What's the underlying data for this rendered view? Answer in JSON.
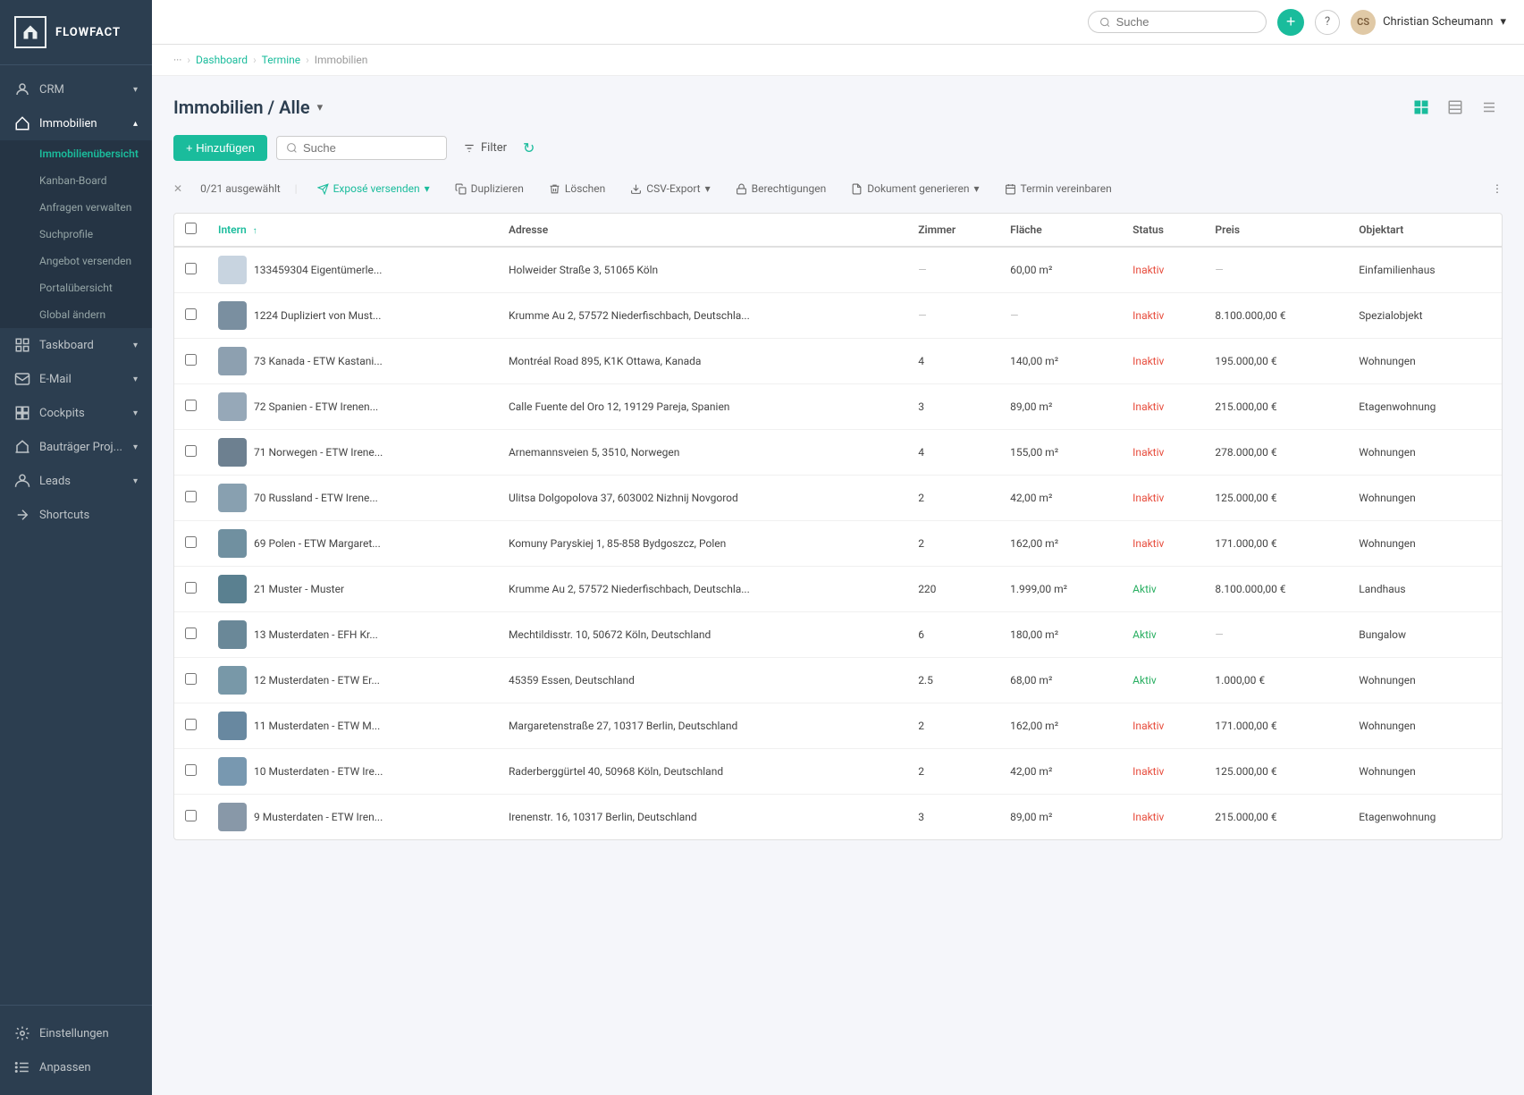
{
  "app": {
    "name": "FLOWFACT"
  },
  "topbar": {
    "search_placeholder": "Suche",
    "add_label": "+",
    "help_label": "?",
    "user_name": "Christian Scheumann",
    "user_initials": "CS"
  },
  "breadcrumb": {
    "more": "...",
    "items": [
      "Dashboard",
      "Termine",
      "Immobilien"
    ]
  },
  "sidebar": {
    "items": [
      {
        "id": "crm",
        "label": "CRM",
        "has_arrow": true
      },
      {
        "id": "immobilien",
        "label": "Immobilien",
        "has_arrow": true,
        "active": true
      },
      {
        "id": "taskboard",
        "label": "Taskboard",
        "has_arrow": true
      },
      {
        "id": "email",
        "label": "E-Mail",
        "has_arrow": true
      },
      {
        "id": "cockpits",
        "label": "Cockpits",
        "has_arrow": true
      },
      {
        "id": "bautraeger",
        "label": "Bauträger Proj...",
        "has_arrow": true
      },
      {
        "id": "leads",
        "label": "Leads",
        "has_arrow": true
      },
      {
        "id": "shortcuts",
        "label": "Shortcuts"
      }
    ],
    "sub_items": [
      {
        "label": "Immobilienübersicht",
        "active": true
      },
      {
        "label": "Kanban-Board"
      },
      {
        "label": "Anfragen verwalten"
      },
      {
        "label": "Suchprofile"
      },
      {
        "label": "Angebot versenden"
      },
      {
        "label": "Portalübersicht"
      },
      {
        "label": "Global ändern"
      }
    ],
    "bottom": [
      {
        "id": "einstellungen",
        "label": "Einstellungen"
      },
      {
        "id": "anpassen",
        "label": "Anpassen"
      }
    ]
  },
  "page": {
    "title": "Immobilien / Alle",
    "add_btn": "+ Hinzufügen",
    "filter_btn": "Filter",
    "search_placeholder": "Suche"
  },
  "selection": {
    "count_label": "0/21 ausgewählt",
    "actions": [
      {
        "id": "expose",
        "label": "Exposé versenden",
        "has_arrow": true
      },
      {
        "id": "duplicate",
        "label": "Duplizieren"
      },
      {
        "id": "delete",
        "label": "Löschen"
      },
      {
        "id": "csv",
        "label": "CSV-Export",
        "has_arrow": true
      },
      {
        "id": "permissions",
        "label": "Berechtigungen"
      },
      {
        "id": "document",
        "label": "Dokument generieren",
        "has_arrow": true
      },
      {
        "id": "appointment",
        "label": "Termin vereinbaren"
      }
    ]
  },
  "table": {
    "columns": [
      {
        "id": "intern",
        "label": "Intern",
        "sorted": true
      },
      {
        "id": "adresse",
        "label": "Adresse"
      },
      {
        "id": "zimmer",
        "label": "Zimmer"
      },
      {
        "id": "flaeche",
        "label": "Fläche"
      },
      {
        "id": "status",
        "label": "Status"
      },
      {
        "id": "preis",
        "label": "Preis"
      },
      {
        "id": "objektart",
        "label": "Objektart"
      }
    ],
    "rows": [
      {
        "id": 1,
        "intern": "133459304 Eigentümerle...",
        "adresse": "Holweider Straße 3, 51065 Köln",
        "zimmer": "—",
        "flaeche": "60,00 m²",
        "status": "Inaktiv",
        "preis": "—",
        "objektart": "Einfamilienhaus",
        "img_color": "#c8d4e0",
        "has_img": false
      },
      {
        "id": 2,
        "intern": "1224  Dupliziert von Must...",
        "adresse": "Krumme Au 2, 57572 Niederfischbach, Deutschla...",
        "zimmer": "—",
        "flaeche": "—",
        "status": "Inaktiv",
        "preis": "8.100.000,00 €",
        "objektart": "Spezialobjekt",
        "img_color": "#7a8fa0",
        "has_img": true
      },
      {
        "id": 3,
        "intern": "73  Kanada - ETW Kastani...",
        "adresse": "Montréal Road 895, K1K Ottawa, Kanada",
        "zimmer": "4",
        "flaeche": "140,00 m²",
        "status": "Inaktiv",
        "preis": "195.000,00 €",
        "objektart": "Wohnungen",
        "img_color": "#8da0b0",
        "has_img": true
      },
      {
        "id": 4,
        "intern": "72  Spanien - ETW Irenen...",
        "adresse": "Calle Fuente del Oro 12, 19129 Pareja, Spanien",
        "zimmer": "3",
        "flaeche": "89,00 m²",
        "status": "Inaktiv",
        "preis": "215.000,00 €",
        "objektart": "Etagenwohnung",
        "img_color": "#96a8b8",
        "has_img": true
      },
      {
        "id": 5,
        "intern": "71  Norwegen - ETW Irene...",
        "adresse": "Arnemannsveien 5, 3510, Norwegen",
        "zimmer": "4",
        "flaeche": "155,00 m²",
        "status": "Inaktiv",
        "preis": "278.000,00 €",
        "objektart": "Wohnungen",
        "img_color": "#6d8090",
        "has_img": true
      },
      {
        "id": 6,
        "intern": "70  Russland - ETW Irene...",
        "adresse": "Ulitsa Dolgopolova 37, 603002 Nizhnij Novgorod",
        "zimmer": "2",
        "flaeche": "42,00 m²",
        "status": "Inaktiv",
        "preis": "125.000,00 €",
        "objektart": "Wohnungen",
        "img_color": "#88a0b0",
        "has_img": true
      },
      {
        "id": 7,
        "intern": "69  Polen - ETW Margaret...",
        "adresse": "Komuny Paryskiej 1, 85-858 Bydgoszcz, Polen",
        "zimmer": "2",
        "flaeche": "162,00 m²",
        "status": "Inaktiv",
        "preis": "171.000,00 €",
        "objektart": "Wohnungen",
        "img_color": "#7090a0",
        "has_img": true
      },
      {
        "id": 8,
        "intern": "21  Muster - Muster",
        "adresse": "Krumme Au 2, 57572 Niederfischbach, Deutschla...",
        "zimmer": "220",
        "flaeche": "1.999,00 m²",
        "status": "Aktiv",
        "preis": "8.100.000,00 €",
        "objektart": "Landhaus",
        "img_color": "#5a8090",
        "has_img": true
      },
      {
        "id": 9,
        "intern": "13  Musterdaten - EFH Kr...",
        "adresse": "Mechtildisstr. 10, 50672 Köln, Deutschland",
        "zimmer": "6",
        "flaeche": "180,00 m²",
        "status": "Aktiv",
        "preis": "—",
        "objektart": "Bungalow",
        "img_color": "#6a8898",
        "has_img": true
      },
      {
        "id": 10,
        "intern": "12  Musterdaten - ETW Er...",
        "adresse": "45359 Essen, Deutschland",
        "zimmer": "2.5",
        "flaeche": "68,00 m²",
        "status": "Aktiv",
        "preis": "1.000,00 €",
        "objektart": "Wohnungen",
        "img_color": "#7898a8",
        "has_img": true
      },
      {
        "id": 11,
        "intern": "11  Musterdaten - ETW M...",
        "adresse": "Margaretenstraße 27, 10317 Berlin, Deutschland",
        "zimmer": "2",
        "flaeche": "162,00 m²",
        "status": "Inaktiv",
        "preis": "171.000,00 €",
        "objektart": "Wohnungen",
        "img_color": "#6888a0",
        "has_img": true
      },
      {
        "id": 12,
        "intern": "10  Musterdaten - ETW Ire...",
        "adresse": "Raderberggürtel 40, 50968 Köln, Deutschland",
        "zimmer": "2",
        "flaeche": "42,00 m²",
        "status": "Inaktiv",
        "preis": "125.000,00 €",
        "objektart": "Wohnungen",
        "img_color": "#7898b0",
        "has_img": true
      },
      {
        "id": 13,
        "intern": "9  Musterdaten - ETW Iren...",
        "adresse": "Irenenstr. 16, 10317 Berlin, Deutschland",
        "zimmer": "3",
        "flaeche": "89,00 m²",
        "status": "Inaktiv",
        "preis": "215.000,00 €",
        "objektart": "Etagenwohnung",
        "img_color": "#8898a8",
        "has_img": true
      }
    ]
  }
}
